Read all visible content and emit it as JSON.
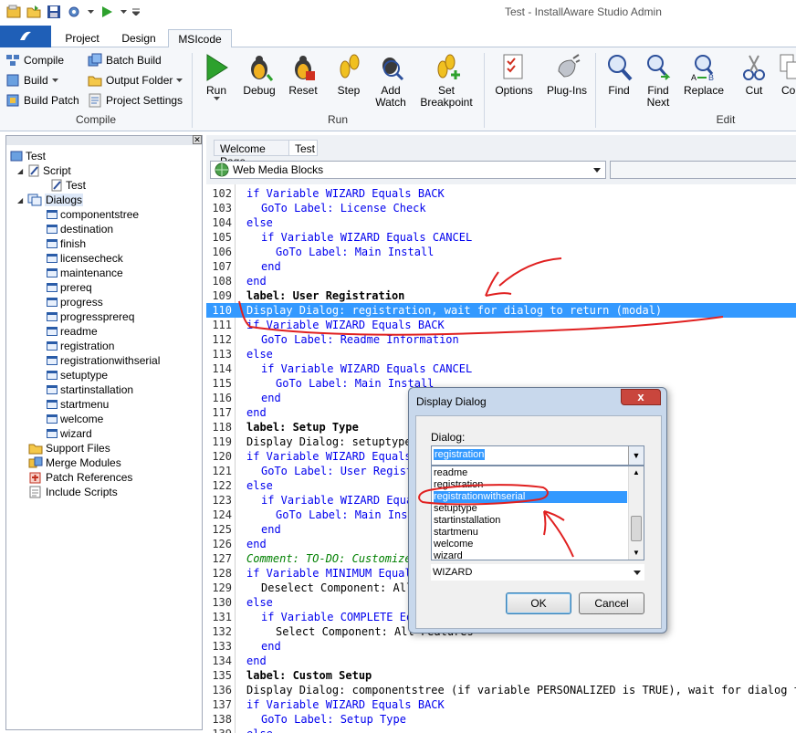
{
  "window": {
    "title": "Test - InstallAware Studio Admin"
  },
  "ribbon_tabs": [
    {
      "label": "Project"
    },
    {
      "label": "Design"
    },
    {
      "label": "MSIcode"
    }
  ],
  "ribbon": {
    "compile_group": {
      "label": "Compile",
      "compile": "Compile",
      "build": "Build",
      "build_patch": "Build Patch",
      "batch_build": "Batch Build",
      "output_folder": "Output Folder",
      "project_settings": "Project Settings"
    },
    "run_group": {
      "label": "Run",
      "run": "Run",
      "debug": "Debug",
      "reset": "Reset",
      "step": "Step",
      "add_watch": [
        "Add",
        "Watch"
      ],
      "set_breakpoint": [
        "Set",
        "Breakpoint"
      ]
    },
    "options": "Options",
    "plugins": "Plug-Ins",
    "edit_group": {
      "label": "Edit",
      "find": "Find",
      "find_next": [
        "Find",
        "Next"
      ],
      "replace": "Replace",
      "cut": "Cut",
      "copy": "Cop"
    }
  },
  "tree": {
    "root": "Test",
    "script": "Script",
    "script_child": "Test",
    "dialogs": "Dialogs",
    "dialog_items": [
      "componentstree",
      "destination",
      "finish",
      "licensecheck",
      "maintenance",
      "prereq",
      "progress",
      "progressprereq",
      "readme",
      "registration",
      "registrationwithserial",
      "setuptype",
      "startinstallation",
      "startmenu",
      "welcome",
      "wizard"
    ],
    "support_files": "Support Files",
    "merge_modules": "Merge Modules",
    "patch_references": "Patch References",
    "include_scripts": "Include Scripts"
  },
  "doc_tabs": [
    {
      "label": "Welcome Page"
    },
    {
      "label": "Test"
    }
  ],
  "toolbar_combo": {
    "value": "Web Media Blocks"
  },
  "code_lines": [
    {
      "n": "102",
      "t": "if Variable WIZARD Equals BACK",
      "c": "bl",
      "i": 0
    },
    {
      "n": "103",
      "t": "GoTo Label: License Check",
      "c": "bl",
      "i": 1
    },
    {
      "n": "104",
      "t": "else",
      "c": "bl",
      "i": 0
    },
    {
      "n": "105",
      "t": "if Variable WIZARD Equals CANCEL",
      "c": "bl",
      "i": 1
    },
    {
      "n": "106",
      "t": "GoTo Label: Main Install",
      "c": "bl",
      "i": 2
    },
    {
      "n": "107",
      "t": "end",
      "c": "bl",
      "i": 1
    },
    {
      "n": "108",
      "t": "end",
      "c": "bl",
      "i": 0
    },
    {
      "n": "109",
      "t": "label: User Registration",
      "c": "kw",
      "i": 0
    },
    {
      "n": "110",
      "t": "Display Dialog: registration, wait for dialog to return (modal)",
      "c": "sel",
      "i": 0
    },
    {
      "n": "111",
      "t": "if Variable WIZARD Equals BACK",
      "c": "bl",
      "i": 0
    },
    {
      "n": "112",
      "t": "GoTo Label: Readme Information",
      "c": "bl",
      "i": 1
    },
    {
      "n": "113",
      "t": "else",
      "c": "bl",
      "i": 0
    },
    {
      "n": "114",
      "t": "if Variable WIZARD Equals CANCEL",
      "c": "bl",
      "i": 1
    },
    {
      "n": "115",
      "t": "GoTo Label: Main Install",
      "c": "bl",
      "i": 2
    },
    {
      "n": "116",
      "t": "end",
      "c": "bl",
      "i": 1
    },
    {
      "n": "117",
      "t": "end",
      "c": "bl",
      "i": 0
    },
    {
      "n": "118",
      "t": "label: Setup Type",
      "c": "kw",
      "i": 0
    },
    {
      "n": "119",
      "t": "Display Dialog: setuptype, wait for dialog to return (modal)",
      "c": "bk",
      "i": 0
    },
    {
      "n": "120",
      "t": "if Variable WIZARD Equals BACK",
      "c": "bl",
      "i": 0
    },
    {
      "n": "121",
      "t": "GoTo Label: User Registration",
      "c": "bl",
      "i": 1
    },
    {
      "n": "122",
      "t": "else",
      "c": "bl",
      "i": 0
    },
    {
      "n": "123",
      "t": "if Variable WIZARD Equals CANCEL",
      "c": "bl",
      "i": 1
    },
    {
      "n": "124",
      "t": "GoTo Label: Main Install",
      "c": "bl",
      "i": 2
    },
    {
      "n": "125",
      "t": "end",
      "c": "bl",
      "i": 1
    },
    {
      "n": "126",
      "t": "end",
      "c": "bl",
      "i": 0
    },
    {
      "n": "127",
      "t": "Comment: TO-DO: Customize your minimum setup here",
      "c": "cm",
      "i": 0
    },
    {
      "n": "128",
      "t": "if Variable MINIMUM Equals TRUE",
      "c": "bl",
      "i": 0
    },
    {
      "n": "129",
      "t": "Deselect Component: All Features",
      "c": "bk",
      "i": 1
    },
    {
      "n": "130",
      "t": "else",
      "c": "bl",
      "i": 0
    },
    {
      "n": "131",
      "t": "if Variable COMPLETE Equals TRUE",
      "c": "bl",
      "i": 1
    },
    {
      "n": "132",
      "t": "Select Component: All Features",
      "c": "bk",
      "i": 2
    },
    {
      "n": "133",
      "t": "end",
      "c": "bl",
      "i": 1
    },
    {
      "n": "134",
      "t": "end",
      "c": "bl",
      "i": 0
    },
    {
      "n": "135",
      "t": "label: Custom Setup",
      "c": "kw",
      "i": 0
    },
    {
      "n": "136",
      "t": "Display Dialog: componentstree (if variable PERSONALIZED is TRUE), wait for dialog to return (modal)",
      "c": "bk",
      "i": 0
    },
    {
      "n": "137",
      "t": "if Variable WIZARD Equals BACK",
      "c": "bl",
      "i": 0
    },
    {
      "n": "138",
      "t": "GoTo Label: Setup Type",
      "c": "bl",
      "i": 1
    },
    {
      "n": "139",
      "t": "else",
      "c": "bl",
      "i": 0
    }
  ],
  "dialog": {
    "title": "Display Dialog",
    "close": "x",
    "label": "Dialog:",
    "selected": "registration",
    "list": [
      "readme",
      "registration",
      "registrationwithserial",
      "setuptype",
      "startinstallation",
      "startmenu",
      "welcome",
      "wizard"
    ],
    "highlighted_index": 2,
    "variable": "WIZARD",
    "ok": "OK",
    "cancel": "Cancel"
  },
  "colors": {
    "accent": "#1f5fb7",
    "selection": "#3399ff",
    "annotation": "#e02020"
  }
}
